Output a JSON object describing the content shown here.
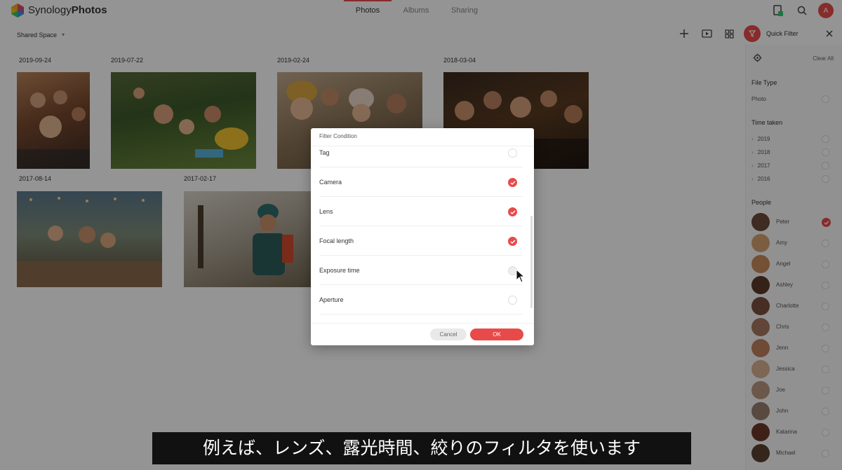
{
  "app": {
    "brand_light": "Synology",
    "brand_bold": "Photos",
    "tabs": [
      {
        "label": "Photos",
        "active": true
      },
      {
        "label": "Albums",
        "active": false
      },
      {
        "label": "Sharing",
        "active": false
      }
    ],
    "avatar_letter": "A",
    "accent_color": "#e84a4a"
  },
  "toolbar": {
    "space_label": "Shared Space",
    "quick_filter_label": "Quick Filter"
  },
  "photos": [
    {
      "date": "2019-09-24",
      "icon": "photo-thumbnail"
    },
    {
      "date": "2019-07-22",
      "icon": "photo-thumbnail"
    },
    {
      "date": "2019-02-24",
      "icon": "photo-thumbnail"
    },
    {
      "date": "2018-03-04",
      "icon": "photo-thumbnail"
    },
    {
      "date": "2017-08-14",
      "icon": "photo-thumbnail"
    },
    {
      "date": "2017-02-17",
      "icon": "photo-thumbnail"
    }
  ],
  "filter_panel": {
    "clear_all": "Clear All",
    "file_type_title": "File Type",
    "file_type_option": "Photo",
    "time_taken_title": "Time taken",
    "years": [
      "2019",
      "2018",
      "2017",
      "2016"
    ],
    "people_title": "People",
    "people": [
      {
        "name": "Peter",
        "checked": true
      },
      {
        "name": "Amy",
        "checked": false
      },
      {
        "name": "Angel",
        "checked": false
      },
      {
        "name": "Ashley",
        "checked": false
      },
      {
        "name": "Charlotte",
        "checked": false
      },
      {
        "name": "Chris",
        "checked": false
      },
      {
        "name": "Jenn",
        "checked": false
      },
      {
        "name": "Jessica",
        "checked": false
      },
      {
        "name": "Joe",
        "checked": false
      },
      {
        "name": "John",
        "checked": false
      },
      {
        "name": "Katarina",
        "checked": false
      },
      {
        "name": "Michael",
        "checked": false
      }
    ]
  },
  "dialog": {
    "title": "Filter Condition",
    "rows": [
      {
        "label": "Tag",
        "checked": false
      },
      {
        "label": "Camera",
        "checked": true
      },
      {
        "label": "Lens",
        "checked": true
      },
      {
        "label": "Focal length",
        "checked": true
      },
      {
        "label": "Exposure time",
        "checked": false
      },
      {
        "label": "Aperture",
        "checked": false
      }
    ],
    "cancel_label": "Cancel",
    "ok_label": "OK"
  },
  "subtitle": "例えば、レンズ、露光時間、絞りのフィルタを使います"
}
